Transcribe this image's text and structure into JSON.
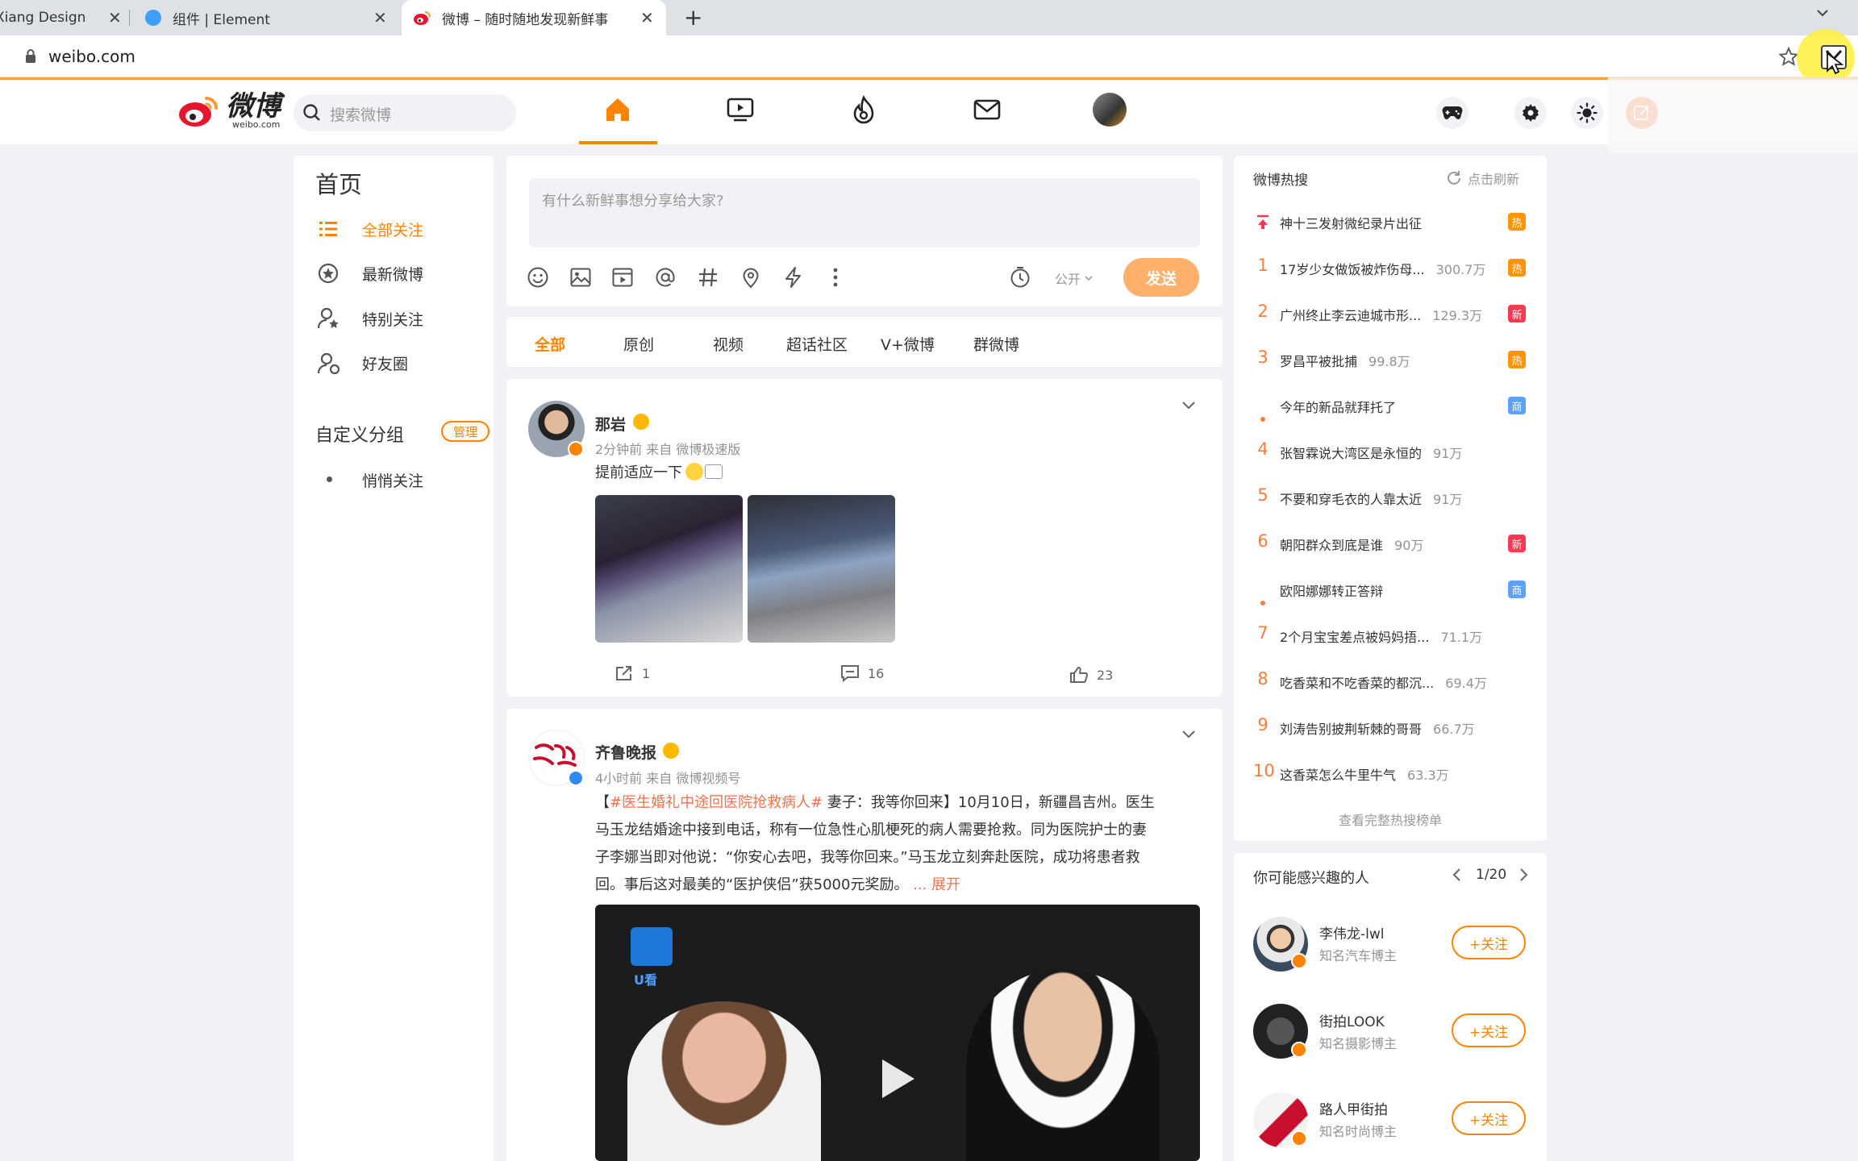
{
  "browser": {
    "tabs": [
      {
        "title": "Xiang Design",
        "close": "✕"
      },
      {
        "title": "组件 | Element",
        "close": "✕"
      },
      {
        "title": "微博 – 随时随地发现新鲜事",
        "close": "✕"
      }
    ],
    "new_tab": "+",
    "url": "weibo.com"
  },
  "topnav": {
    "logo_text": "微博",
    "logo_sub": "weibo.com",
    "search_placeholder": "搜索微博",
    "icons": [
      "home-icon",
      "video-icon",
      "hot-icon",
      "message-icon",
      "profile-avatar"
    ],
    "right_icons": [
      "game-icon",
      "settings-icon",
      "theme-icon",
      "compose-icon"
    ]
  },
  "sidebar": {
    "title": "首页",
    "items": [
      {
        "label": "全部关注",
        "active": true
      },
      {
        "label": "最新微博"
      },
      {
        "label": "特别关注"
      },
      {
        "label": "好友圈"
      }
    ],
    "group_title": "自定义分组",
    "manage_label": "管理",
    "group_items": [
      {
        "label": "悄悄关注"
      }
    ]
  },
  "composer": {
    "placeholder": "有什么新鲜事想分享给大家?",
    "visibility": "公开",
    "send_label": "发送"
  },
  "feed_tabs": [
    "全部",
    "原创",
    "视频",
    "超话社区",
    "V+微博",
    "群微博"
  ],
  "posts": [
    {
      "author": "那岩",
      "meta": "2分钟前  来自 微博极速版",
      "text": "提前适应一下",
      "reposts": "1",
      "comments": "16",
      "likes": "23"
    },
    {
      "author": "齐鲁晚报",
      "meta": "4小时前  来自 微博视频号",
      "text_prefix": "【",
      "hashtag": "#医生婚礼中途回医院抢救病人#",
      "text_lines": [
        " 妻子：我等你回来】10月10日，新疆昌吉州。医生",
        "马玉龙结婚途中接到电话，称有一位急性心肌梗死的病人需要抢救。同为医院护士的妻",
        "子李娜当即对他说：“你安心去吧，我等你回来。”马玉龙立刻奔赴医院，成功将患者救",
        "回。事后这对最美的“医护侠侣”获5000元奖励。"
      ],
      "ellipsis": "...",
      "expand": "展开",
      "video_logo": "U看"
    }
  ],
  "hot_search": {
    "title": "微博热搜",
    "refresh": "点击刷新",
    "items": [
      {
        "rank": "top",
        "title": "神十三发射微纪录片出征",
        "num": "",
        "badge": "热",
        "badge_color": "#ff9406"
      },
      {
        "rank": "1",
        "title": "17岁少女做饭被炸伤母...",
        "num": "300.7万",
        "badge": "热",
        "badge_color": "#ff9406"
      },
      {
        "rank": "2",
        "title": "广州终止李云迪城市形...",
        "num": "129.3万",
        "badge": "新",
        "badge_color": "#ff3852"
      },
      {
        "rank": "3",
        "title": "罗昌平被批捕",
        "num": "99.8万",
        "badge": "热",
        "badge_color": "#ff9406"
      },
      {
        "rank": "dot",
        "title": "今年的新品就拜托了",
        "num": "",
        "badge": "商",
        "badge_color": "#5ea1f7"
      },
      {
        "rank": "4",
        "title": "张智霖说大湾区是永恒的",
        "num": "91万",
        "badge": "",
        "badge_color": ""
      },
      {
        "rank": "5",
        "title": "不要和穿毛衣的人靠太近",
        "num": "91万",
        "badge": "",
        "badge_color": ""
      },
      {
        "rank": "6",
        "title": "朝阳群众到底是谁",
        "num": "90万",
        "badge": "新",
        "badge_color": "#ff3852"
      },
      {
        "rank": "dot",
        "title": "欧阳娜娜转正答辩",
        "num": "",
        "badge": "商",
        "badge_color": "#5ea1f7"
      },
      {
        "rank": "7",
        "title": "2个月宝宝差点被妈妈捂...",
        "num": "71.1万",
        "badge": "",
        "badge_color": ""
      },
      {
        "rank": "8",
        "title": "吃香菜和不吃香菜的都沉...",
        "num": "69.4万",
        "badge": "",
        "badge_color": ""
      },
      {
        "rank": "9",
        "title": "刘涛告别披荆斩棘的哥哥",
        "num": "66.7万",
        "badge": "",
        "badge_color": ""
      },
      {
        "rank": "10",
        "title": "这香菜怎么牛里牛气",
        "num": "63.3万",
        "badge": "",
        "badge_color": ""
      }
    ],
    "view_all": "查看完整热搜榜单"
  },
  "suggestions": {
    "title": "你可能感兴趣的人",
    "pager": "1/20",
    "people": [
      {
        "name": "李伟龙-lwl",
        "desc": "知名汽车博主",
        "follow": "+关注"
      },
      {
        "name": "街拍LOOK",
        "desc": "知名摄影博主",
        "follow": "+关注"
      },
      {
        "name": "路人甲街拍",
        "desc": "知名时尚博主",
        "follow": "+关注"
      }
    ]
  },
  "colors": {
    "accent": "#ff8200",
    "hot_rank": "#fa7d3c",
    "link": "#eb7350"
  }
}
